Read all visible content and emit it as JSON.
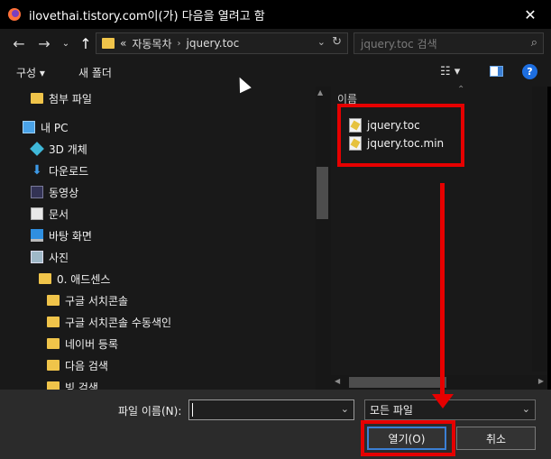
{
  "window": {
    "title": "ilovethai.tistory.com이(가) 다음을 열려고 함",
    "close_glyph": "✕"
  },
  "address": {
    "prefix": "«",
    "crumbs": [
      "자동목차",
      "jquery.toc"
    ],
    "separator": "›",
    "search_placeholder": "jquery.toc 검색"
  },
  "toolbar": {
    "organize_label": "구성 ▾",
    "new_folder_label": "새 폴더",
    "help_label": "?",
    "view_glyph": "☷ ▾"
  },
  "nav": {
    "items": [
      {
        "label": "첨부 파일",
        "icon": "folder-icon"
      },
      {
        "label": "내 PC",
        "icon": "pc-icon"
      },
      {
        "label": "3D 개체",
        "icon": "3d-objects-icon"
      },
      {
        "label": "다운로드",
        "icon": "download-icon"
      },
      {
        "label": "동영상",
        "icon": "video-icon"
      },
      {
        "label": "문서",
        "icon": "document-icon"
      },
      {
        "label": "바탕 화면",
        "icon": "desktop-icon"
      },
      {
        "label": "사진",
        "icon": "picture-icon"
      },
      {
        "label": "0. 애드센스",
        "icon": "folder-icon"
      },
      {
        "label": "구글 서치콘솔",
        "icon": "folder-icon"
      },
      {
        "label": "구글 서치콘솔 수동색인",
        "icon": "folder-icon"
      },
      {
        "label": "네이버 등록",
        "icon": "folder-icon"
      },
      {
        "label": "다음 검색",
        "icon": "folder-icon"
      },
      {
        "label": "빙 검색",
        "icon": "folder-icon"
      }
    ]
  },
  "files": {
    "column_name": "이름",
    "items": [
      {
        "name": "jquery.toc",
        "icon": "js-file-icon"
      },
      {
        "name": "jquery.toc.min",
        "icon": "js-file-icon"
      }
    ]
  },
  "bottom": {
    "filename_label": "파일 이름(N):",
    "filename_value": "",
    "filter_value": "모든 파일",
    "open_label": "열기(O)",
    "cancel_label": "취소"
  },
  "annotations": {
    "highlight_color": "#e60000"
  }
}
